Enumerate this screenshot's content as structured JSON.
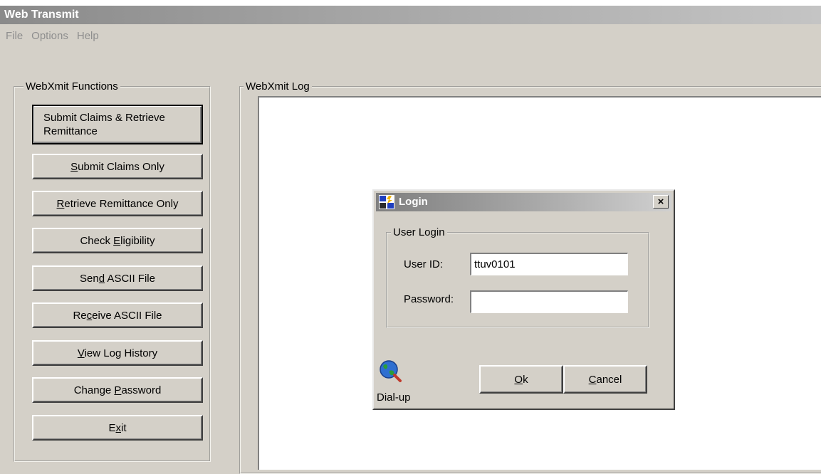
{
  "window": {
    "title": "Web Transmit"
  },
  "menu": [
    "File",
    "Options",
    "Help"
  ],
  "functions_group": {
    "legend": "WebXmit Functions",
    "buttons": [
      {
        "id": "submit-claims-retrieve",
        "pre": "Submit Claims &  Retrieve",
        "pre2": "Remittance",
        "key": "",
        "post": ""
      },
      {
        "id": "submit-claims-only",
        "pre": "",
        "key": "S",
        "post": "ubmit Claims Only"
      },
      {
        "id": "retrieve-remittance-only",
        "pre": "",
        "key": "R",
        "post": "etrieve Remittance Only"
      },
      {
        "id": "check-eligibility",
        "pre": "Check ",
        "key": "E",
        "post": "ligibility"
      },
      {
        "id": "send-ascii-file",
        "pre": "Sen",
        "key": "d",
        "post": " ASCII File"
      },
      {
        "id": "receive-ascii-file",
        "pre": "Re",
        "key": "c",
        "post": "eive ASCII File"
      },
      {
        "id": "view-log-history",
        "pre": "",
        "key": "V",
        "post": "iew Log History"
      },
      {
        "id": "change-password",
        "pre": "Change ",
        "key": "P",
        "post": "assword"
      },
      {
        "id": "exit",
        "pre": "E",
        "key": "x",
        "post": "it"
      }
    ]
  },
  "log_group": {
    "legend": "WebXmit Log"
  },
  "login_dialog": {
    "title": "Login",
    "close_glyph": "×",
    "group_legend": "User Login",
    "user_id_label": "User ID:",
    "user_id_value": "ttuv0101",
    "password_label": "Password:",
    "password_value": "",
    "dialup_label": "Dial-up",
    "ok": {
      "key": "O",
      "post": "k"
    },
    "cancel": {
      "key": "C",
      "post": "ancel"
    }
  },
  "icons": {
    "app": "login-app-icon",
    "dialup": "globe-magnifier-icon"
  }
}
